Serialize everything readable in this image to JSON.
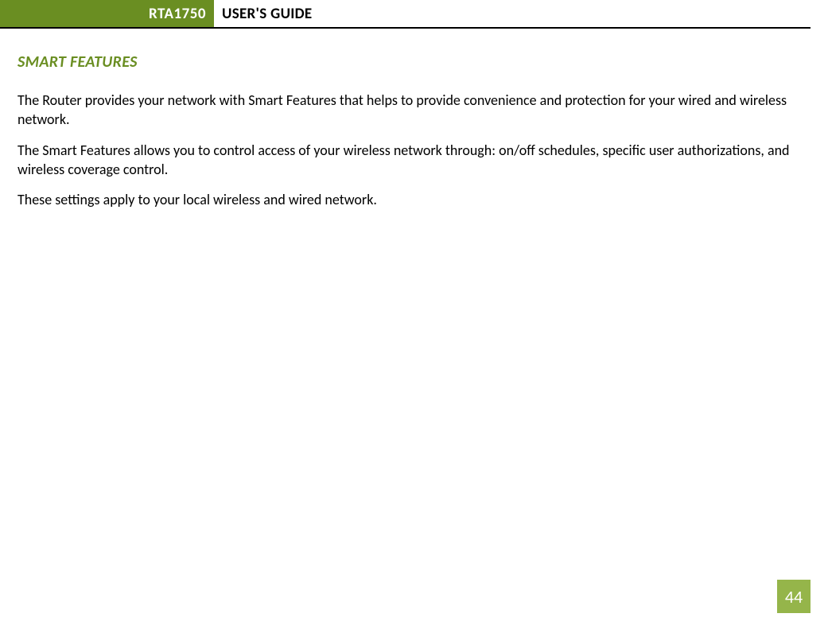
{
  "header": {
    "model": "RTA1750",
    "title": "USER'S GUIDE"
  },
  "section": {
    "heading": "SMART FEATURES",
    "paragraphs": [
      "The Router provides your network with Smart Features that helps to provide convenience and protection for your wired and wireless network.",
      "The Smart Features allows you to control access of your wireless network through: on/off schedules, specific user authorizations, and wireless coverage control.",
      "These settings apply to your local wireless and wired network."
    ]
  },
  "page_number": "44"
}
